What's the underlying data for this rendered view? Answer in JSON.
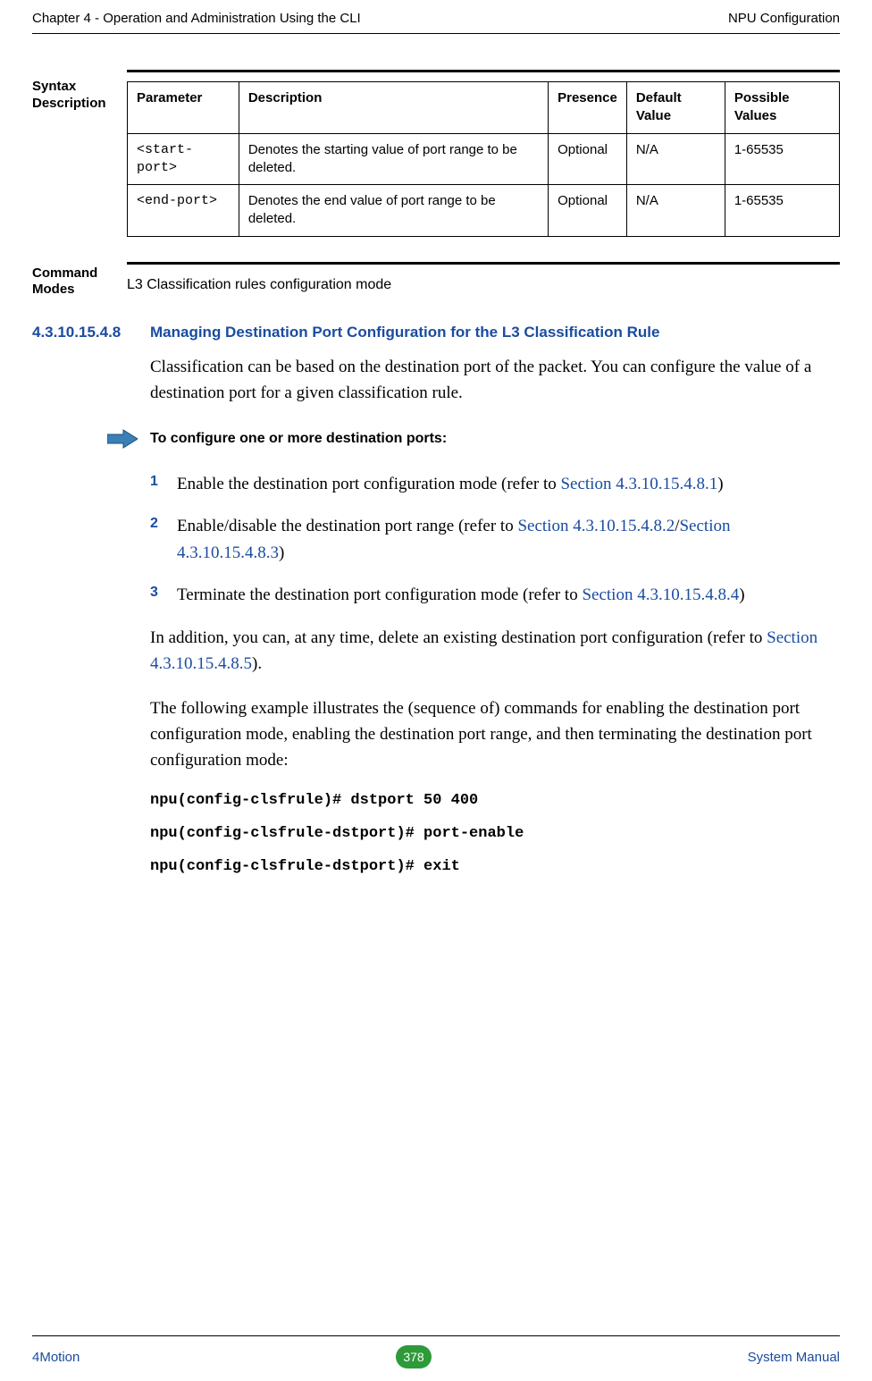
{
  "header": {
    "left": "Chapter 4 - Operation and Administration Using the CLI",
    "right": "NPU Configuration"
  },
  "syntax": {
    "label": "Syntax Description",
    "columns": {
      "parameter": "Parameter",
      "description": "Description",
      "presence": "Presence",
      "default": "Default Value",
      "possible": "Possible Values"
    },
    "rows": [
      {
        "parameter": "<start-port>",
        "description": "Denotes the starting value of port range to be deleted.",
        "presence": "Optional",
        "default": "N/A",
        "possible": "1-65535"
      },
      {
        "parameter": "<end-port>",
        "description": "Denotes the end value of port range to be deleted.",
        "presence": "Optional",
        "default": "N/A",
        "possible": "1-65535"
      }
    ]
  },
  "command_modes": {
    "label": "Command Modes",
    "text": "L3 Classification rules configuration mode"
  },
  "section": {
    "number": "4.3.10.15.4.8",
    "title": "Managing Destination Port Configuration for the L3 Classification Rule",
    "intro": "Classification can be based on the destination port of the packet. You can configure the value of a destination port for a given classification rule.",
    "procedure_title": "To configure one or more destination ports:",
    "steps": [
      {
        "num": "1",
        "text_before": "Enable the destination port configuration mode (refer to ",
        "link": "Section 4.3.10.15.4.8.1",
        "text_after": ")"
      },
      {
        "num": "2",
        "text_before": "Enable/disable the destination port range (refer to ",
        "link": "Section 4.3.10.15.4.8.2",
        "sep": "/",
        "link2": "Section 4.3.10.15.4.8.3",
        "text_after": ")"
      },
      {
        "num": "3",
        "text_before": "Terminate the destination port configuration mode (refer to ",
        "link": "Section 4.3.10.15.4.8.4",
        "text_after": ")"
      }
    ],
    "addition_before": "In addition, you can, at any time, delete an existing destination port configuration (refer to ",
    "addition_link": "Section 4.3.10.15.4.8.5",
    "addition_after": ").",
    "example_intro": "The following example illustrates the (sequence of) commands for enabling the destination port configuration mode, enabling the destination port range, and then terminating the destination port configuration mode:",
    "commands": [
      "npu(config-clsfrule)# dstport 50 400",
      "npu(config-clsfrule-dstport)# port-enable",
      "npu(config-clsfrule-dstport)# exit"
    ]
  },
  "footer": {
    "left": "4Motion",
    "page": "378",
    "right": "System Manual"
  }
}
